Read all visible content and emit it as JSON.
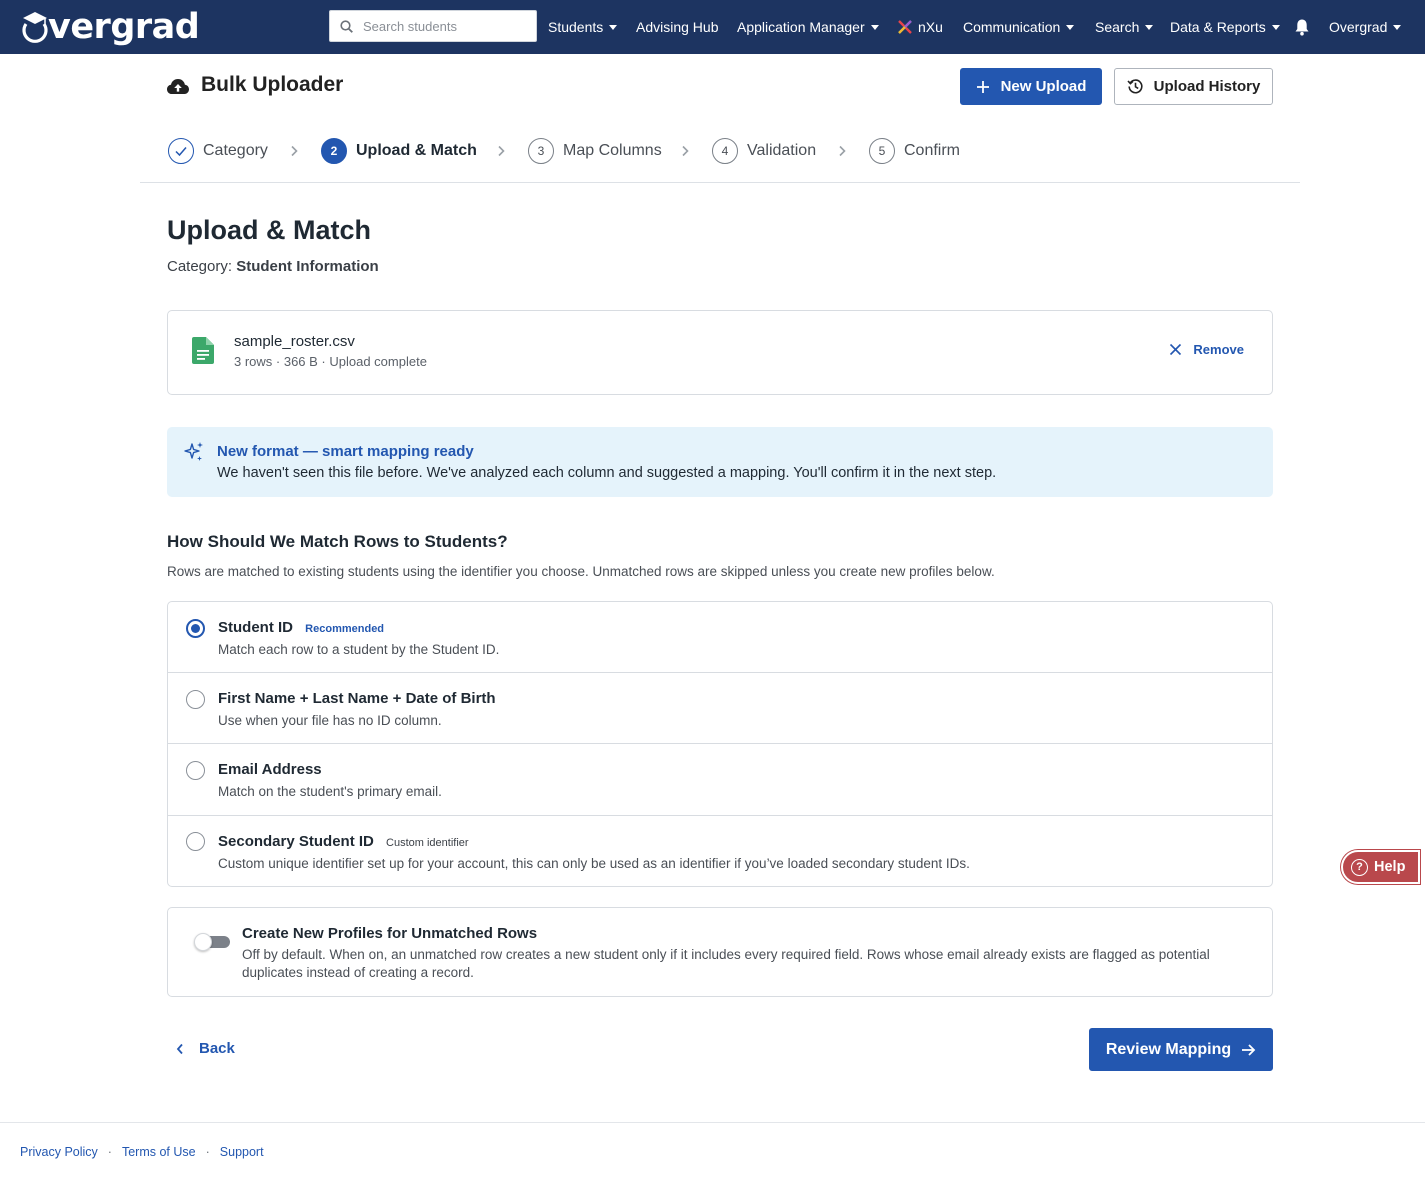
{
  "nav": {
    "logo_text": "vergrad",
    "search_placeholder": "Search students",
    "items": [
      {
        "label": "Students"
      },
      {
        "label": "Advising Hub"
      },
      {
        "label": "Application Manager"
      },
      {
        "label": "nXu"
      },
      {
        "label": "Communication"
      },
      {
        "label": "Search"
      },
      {
        "label": "Data & Reports"
      },
      {
        "label": "Overgrad"
      }
    ]
  },
  "header": {
    "title": "Bulk Uploader",
    "new_upload_label": "New Upload",
    "upload_history_label": "Upload History"
  },
  "steps": [
    {
      "number": "",
      "label": "Category",
      "state": "done"
    },
    {
      "number": "2",
      "label": "Upload & Match",
      "state": "active"
    },
    {
      "number": "3",
      "label": "Map Columns",
      "state": "pending"
    },
    {
      "number": "4",
      "label": "Validation",
      "state": "pending"
    },
    {
      "number": "5",
      "label": "Confirm",
      "state": "pending"
    }
  ],
  "main": {
    "title": "Upload & Match",
    "category_label": "Category:",
    "category_value": "Student Information"
  },
  "file": {
    "name": "sample_roster.csv",
    "meta": "3 rows · 366 B · Upload complete",
    "remove_label": "Remove"
  },
  "banner": {
    "title": "New format — smart mapping ready",
    "body": "We haven't seen this file before. We've analyzed each column and suggested a mapping. You'll confirm it in the next step."
  },
  "match": {
    "heading": "How Should We Match Rows to Students?",
    "subtext": "Rows are matched to existing students using the identifier you choose. Unmatched rows are skipped unless you create new profiles below.",
    "options": [
      {
        "title": "Student ID",
        "badge": "Recommended",
        "description": "Match each row to a student by the Student ID.",
        "selected": true
      },
      {
        "title": "First Name + Last Name + Date of Birth",
        "badge": "",
        "description": "Use when your file has no ID column.",
        "selected": false
      },
      {
        "title": "Email Address",
        "badge": "",
        "description": "Match on the student's primary email.",
        "selected": false
      },
      {
        "title": "Secondary Student ID",
        "badge": "Custom identifier",
        "description": "Custom unique identifier set up for your account, this can only be used as an identifier if you’ve loaded secondary student IDs.",
        "selected": false
      }
    ]
  },
  "create_profiles": {
    "title": "Create New Profiles for Unmatched Rows",
    "description": "Off by default. When on, an unmatched row creates a new student only if it includes every required field. Rows whose email already exists are flagged as potential duplicates instead of creating a record.",
    "enabled": false
  },
  "actions": {
    "back_label": "Back",
    "review_label": "Review Mapping"
  },
  "footer": {
    "privacy": "Privacy Policy",
    "terms": "Terms of Use",
    "support": "Support",
    "separator": "·"
  },
  "help_label": "Help",
  "colors": {
    "nav_bg": "#1d3461",
    "primary": "#2357b0",
    "banner_bg": "#e5f3fb",
    "help_bg": "#b9484c",
    "file_icon": "#3ca86a"
  },
  "icons": [
    "cloud-upload-icon",
    "plus-icon",
    "history-icon",
    "check-icon",
    "chevron-right-icon",
    "file-icon",
    "close-icon",
    "sparkles-icon",
    "chevron-left-icon",
    "arrow-right-icon",
    "bell-icon",
    "search-icon",
    "question-icon",
    "nxu-logo-icon"
  ]
}
